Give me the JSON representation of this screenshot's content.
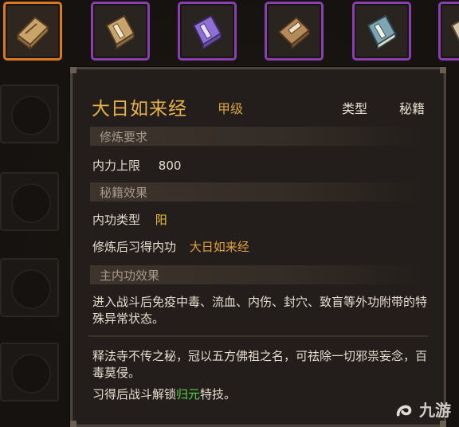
{
  "inventory": {
    "slots": [
      {
        "icon": "scroll-book-icon",
        "selected": true,
        "color": "#c9a46a"
      },
      {
        "icon": "book-icon",
        "selected": false,
        "color": "#c8a46c"
      },
      {
        "icon": "book-icon",
        "selected": false,
        "color": "#8f6fd6"
      },
      {
        "icon": "book-icon",
        "selected": false,
        "color": "#b58a5a"
      },
      {
        "icon": "book-icon",
        "selected": false,
        "color": "#7fa5b3"
      },
      {
        "icon": "book-icon",
        "selected": false,
        "color": "#d9c8a8"
      }
    ]
  },
  "tooltip": {
    "title": "大日如来经",
    "grade": "甲级",
    "type_label": "类型",
    "type_value": "秘籍",
    "sections": {
      "requirements": "修炼要求",
      "effects": "秘籍效果",
      "main_effect": "主内功效果"
    },
    "requirements": {
      "label": "内力上限",
      "value": "800"
    },
    "effects": {
      "kind_label": "内功类型",
      "kind_value": "阳",
      "learn_label": "修炼后习得内功",
      "learn_value": "大日如来经"
    },
    "main_effect_text": "进入战斗后免疫中毒、流血、内伤、封穴、致盲等外功附带的特殊异常状态。",
    "description": "释法寺不传之秘，冠以五方佛祖之名，可祛除一切邪祟妄念，百毒莫侵。",
    "learn_skill": {
      "prefix": "习得后战斗解锁",
      "skill": "归元",
      "suffix": "特技。"
    }
  },
  "watermark": {
    "text": "九游"
  },
  "colors": {
    "title": "#e8b24a",
    "selected_border": "#d97a1c",
    "slot_border": "#8a3fb0",
    "skill_highlight": "#58d44a"
  }
}
